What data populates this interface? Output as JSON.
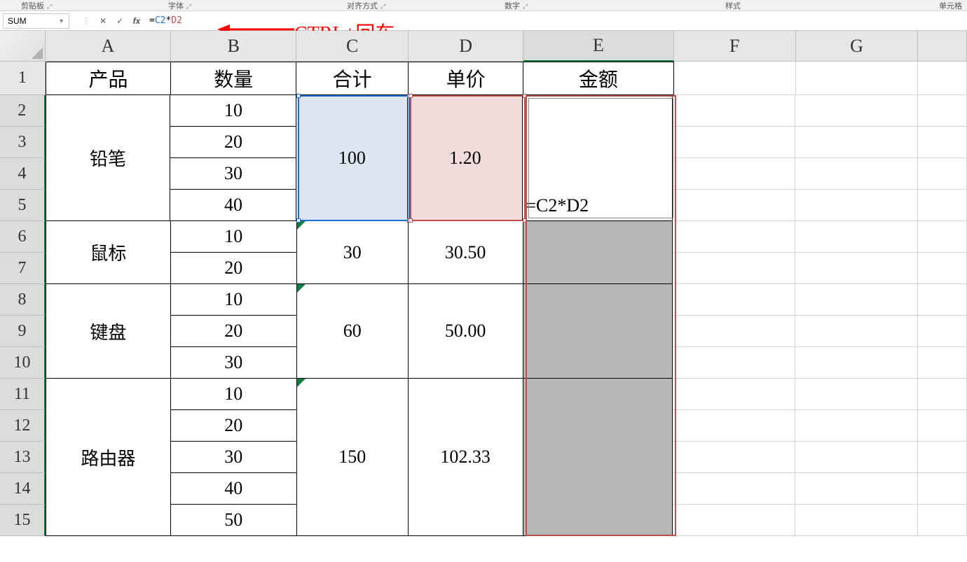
{
  "ribbon_groups": {
    "clipboard": "剪贴板",
    "font": "字体",
    "alignment": "对齐方式",
    "number": "数字",
    "styles": "样式",
    "cells": "单元格"
  },
  "name_box": "SUM",
  "fb_cancel": "✕",
  "fb_enter": "✓",
  "fx_label": "fx",
  "formula_eq": "=",
  "formula_refC": "C2",
  "formula_op": "*",
  "formula_refD": "D2",
  "annotation": "CTRL+回车",
  "columns": [
    "A",
    "B",
    "C",
    "D",
    "E",
    "F",
    "G"
  ],
  "row_numbers": [
    "1",
    "2",
    "3",
    "4",
    "5",
    "6",
    "7",
    "8",
    "9",
    "10",
    "11",
    "12",
    "13",
    "14",
    "15"
  ],
  "hdr": {
    "A": "产品",
    "B": "数量",
    "C": "合计",
    "D": "单价",
    "E": "金额"
  },
  "qty": {
    "r2": "10",
    "r3": "20",
    "r4": "30",
    "r5": "40",
    "r6": "10",
    "r7": "20",
    "r8": "10",
    "r9": "20",
    "r10": "30",
    "r11": "10",
    "r12": "20",
    "r13": "30",
    "r14": "40",
    "r15": "50"
  },
  "prod": {
    "p1": "铅笔",
    "p2": "鼠标",
    "p3": "键盘",
    "p4": "路由器"
  },
  "subtotal": {
    "s1": "100",
    "s2": "30",
    "s3": "60",
    "s4": "150"
  },
  "price": {
    "u1": "1.20",
    "u2": "30.50",
    "u3": "50.00",
    "u4": "102.33"
  },
  "cell_formula": "=C2*D2"
}
